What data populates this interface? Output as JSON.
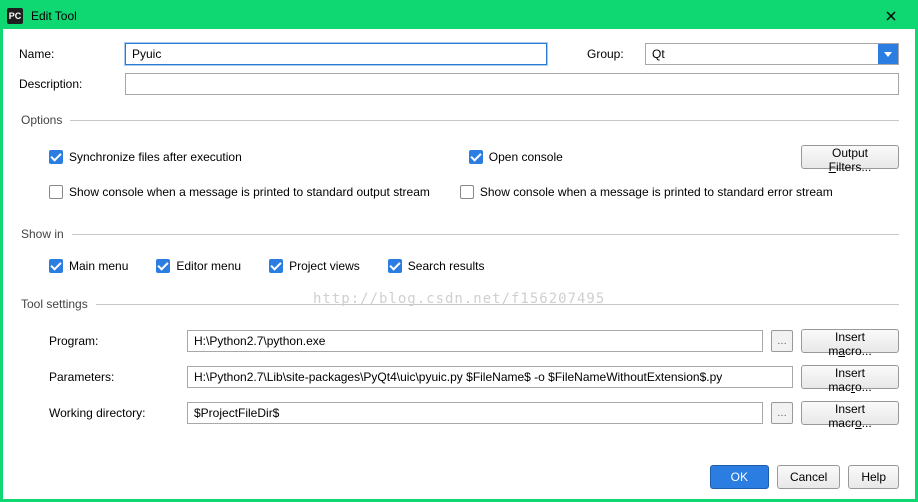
{
  "titlebar": {
    "title": "Edit Tool"
  },
  "form": {
    "name_label": "Name:",
    "name_value": "Pyuic",
    "group_label": "Group:",
    "group_value": "Qt",
    "desc_label": "Description:",
    "desc_value": ""
  },
  "options": {
    "legend": "Options",
    "sync_label": "Synchronize files after execution",
    "sync_checked": true,
    "open_console_label": "Open console",
    "open_console_checked": true,
    "output_filters_btn": "Output Filters...",
    "stdout_label": "Show console when a message is printed to standard output stream",
    "stdout_checked": false,
    "stderr_label": "Show console when a message is printed to standard error stream",
    "stderr_checked": false
  },
  "showin": {
    "legend": "Show in",
    "main_menu": "Main menu",
    "editor_menu": "Editor menu",
    "project_views": "Project views",
    "search_results": "Search results",
    "main_menu_checked": true,
    "editor_menu_checked": true,
    "project_views_checked": true,
    "search_results_checked": true
  },
  "tool": {
    "legend": "Tool settings",
    "program_label": "Program:",
    "program_value": "H:\\Python2.7\\python.exe",
    "params_label": "Parameters:",
    "params_value": "H:\\Python2.7\\Lib\\site-packages\\PyQt4\\uic\\pyuic.py $FileName$ -o $FileNameWithoutExtension$.py",
    "workdir_label": "Working directory:",
    "workdir_value": "$ProjectFileDir$",
    "insert_macro": "Insert macro...",
    "browse": "…"
  },
  "footer": {
    "ok": "OK",
    "cancel": "Cancel",
    "help": "Help"
  },
  "watermark": "http://blog.csdn.net/f156207495"
}
